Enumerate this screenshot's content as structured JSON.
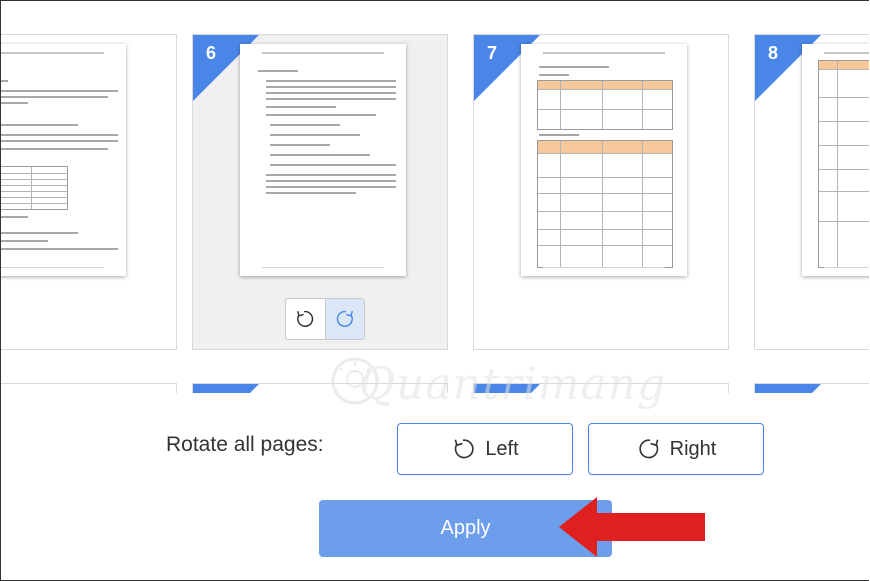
{
  "pages": [
    {
      "number": "",
      "selected": false
    },
    {
      "number": "6",
      "selected": true
    },
    {
      "number": "7",
      "selected": false
    },
    {
      "number": "8",
      "selected": false
    }
  ],
  "rotate_controls": {
    "left_icon": "rotate-ccw-icon",
    "right_icon": "rotate-cw-icon"
  },
  "rotate_all": {
    "label": "Rotate all pages:",
    "left_label": "Left",
    "right_label": "Right"
  },
  "apply_label": "Apply",
  "watermark": "Quantrimang",
  "colors": {
    "accent": "#4a86e8",
    "apply": "#6d9eeb",
    "arrow": "#e02020",
    "selected_card": "#f0f0f0"
  }
}
